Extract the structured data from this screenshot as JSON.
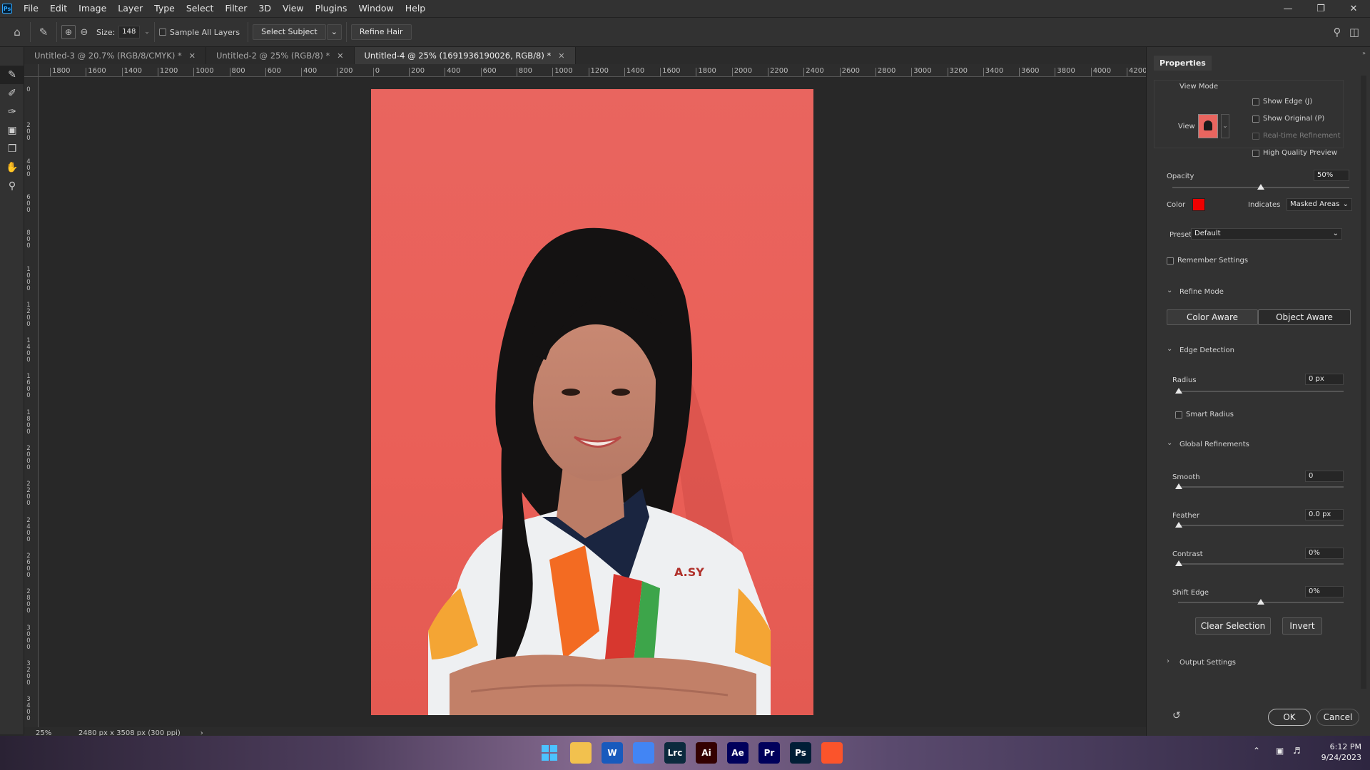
{
  "menubar": {
    "logo": "Ps",
    "items": [
      "File",
      "Edit",
      "Image",
      "Layer",
      "Type",
      "Select",
      "Filter",
      "3D",
      "View",
      "Plugins",
      "Window",
      "Help"
    ]
  },
  "options": {
    "size_label": "Size:",
    "size_value": "148",
    "sample_all_layers": "Sample All Layers",
    "select_subject": "Select Subject",
    "refine_hair": "Refine Hair"
  },
  "tabs": [
    {
      "label": "Untitled-3 @ 20.7% (RGB/8/CMYK) *"
    },
    {
      "label": "Untitled-2 @ 25% (RGB/8) *"
    },
    {
      "label": "Untitled-4 @ 25% (1691936190026, RGB/8) *"
    }
  ],
  "ruler": {
    "h_ticks": [
      "1800",
      "1600",
      "1400",
      "1200",
      "1000",
      "800",
      "600",
      "400",
      "200",
      "0",
      "200",
      "400",
      "600",
      "800",
      "1000",
      "1200",
      "1400",
      "1600",
      "1800",
      "2000",
      "2200",
      "2400",
      "2600",
      "2800",
      "3000",
      "3200",
      "3400",
      "3600",
      "3800",
      "4000",
      "4200"
    ],
    "v_ticks": [
      "0",
      "200",
      "400",
      "600",
      "800",
      "1000",
      "1200",
      "1400",
      "1600",
      "1800",
      "2000",
      "2200",
      "2400",
      "2600",
      "2800",
      "3000",
      "3200",
      "3400"
    ]
  },
  "status": {
    "zoom": "25%",
    "doc_size": "2480 px x 3508 px (300 ppi)",
    "arrow": "›"
  },
  "properties": {
    "title": "Properties",
    "view_mode": "View Mode",
    "view_label": "View",
    "show_edge": "Show Edge (J)",
    "show_original": "Show Original (P)",
    "realtime": "Real-time Refinement",
    "high_quality": "High Quality Preview",
    "opacity_label": "Opacity",
    "opacity_value": "50%",
    "opacity_level": 0.5,
    "color_label": "Color",
    "overlay_color": "#ee0000",
    "indicates_label": "Indicates",
    "indicates_value": "Masked Areas",
    "preset_label": "Preset",
    "preset_value": "Default",
    "remember": "Remember Settings",
    "refine_mode": "Refine Mode",
    "color_aware": "Color Aware",
    "object_aware": "Object Aware",
    "edge_detection": "Edge Detection",
    "radius_label": "Radius",
    "radius_value": "0 px",
    "smart_radius": "Smart Radius",
    "global_refinements": "Global Refinements",
    "smooth_label": "Smooth",
    "smooth_value": "0",
    "feather_label": "Feather",
    "feather_value": "0.0 px",
    "contrast_label": "Contrast",
    "contrast_value": "0%",
    "shift_label": "Shift Edge",
    "shift_value": "0%",
    "clear_selection": "Clear Selection",
    "invert": "Invert",
    "output_settings": "Output Settings",
    "ok": "OK",
    "cancel": "Cancel"
  },
  "taskbar": {
    "time": "6:12 PM",
    "date": "9/24/2023",
    "apps": [
      {
        "name": "word-icon",
        "text": "W",
        "color": "#185abd"
      },
      {
        "name": "chrome-icon",
        "text": "",
        "color": "#4285f4"
      },
      {
        "name": "lightroom-classic-icon",
        "text": "Lrc",
        "color": "#0b2a3d"
      },
      {
        "name": "illustrator-icon",
        "text": "Ai",
        "color": "#330000"
      },
      {
        "name": "after-effects-icon",
        "text": "Ae",
        "color": "#00005b"
      },
      {
        "name": "premiere-icon",
        "text": "Pr",
        "color": "#00005b"
      },
      {
        "name": "photoshop-icon",
        "text": "Ps",
        "color": "#001e36"
      },
      {
        "name": "brave-icon",
        "text": "",
        "color": "#fb542b"
      }
    ]
  },
  "document": {
    "jersey_text": "A.SY"
  }
}
